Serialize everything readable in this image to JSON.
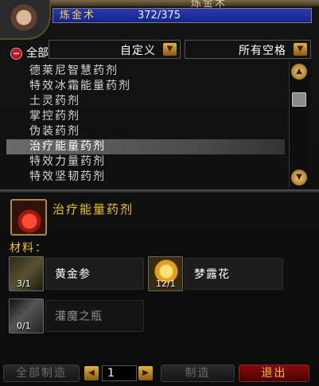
{
  "header": {
    "title": "炼金术",
    "skill_name": "炼金术",
    "skill_rank": "372/375"
  },
  "filters": {
    "all_label": "全部",
    "collapse_symbol": "−",
    "subclass": "自定义",
    "slot": "所有空格"
  },
  "recipes": [
    {
      "name": "德莱尼智慧药剂",
      "selected": false
    },
    {
      "name": "特效冰霜能量药剂",
      "selected": false
    },
    {
      "name": "土灵药剂",
      "selected": false
    },
    {
      "name": "掌控药剂",
      "selected": false
    },
    {
      "name": "伪装药剂",
      "selected": false
    },
    {
      "name": "治疗能量药剂",
      "selected": true
    },
    {
      "name": "特效力量药剂",
      "selected": false
    },
    {
      "name": "特效坚韧药剂",
      "selected": false
    }
  ],
  "detail": {
    "result_name": "治疗能量药剂",
    "materials_label": "材料：",
    "reagents": [
      {
        "name": "黄金参",
        "count": "3/1",
        "icon": "herb-root-icon",
        "available": true
      },
      {
        "name": "梦露花",
        "count": "12/1",
        "icon": "golden-flower-icon",
        "available": true
      },
      {
        "name": "灌魔之瓶",
        "count": "0/1",
        "icon": "vial-icon",
        "available": false
      }
    ]
  },
  "controls": {
    "create_all": "全部制造",
    "quantity": "1",
    "create": "制造",
    "exit": "退出"
  }
}
